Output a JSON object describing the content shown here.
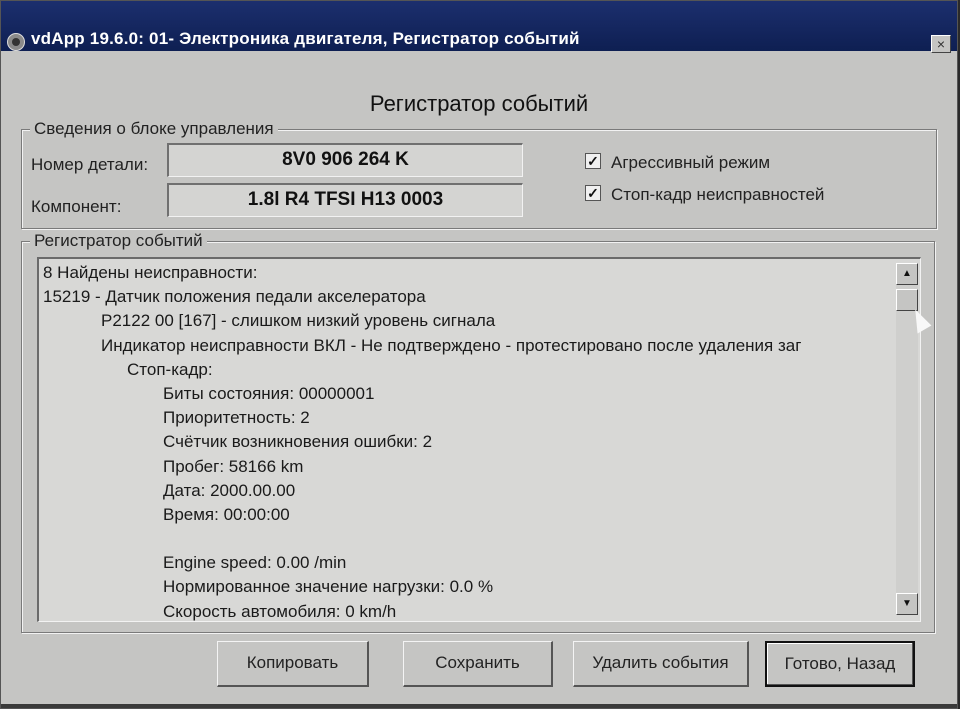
{
  "window": {
    "title": "vdApp 19.6.0: 01- Электроника двигателя, Регистратор событий",
    "close_glyph": "×"
  },
  "heading": "Регистратор событий",
  "control_unit": {
    "legend": "Сведения о блоке управления",
    "part_number_label": "Номер детали:",
    "part_number_value": "8V0 906 264 K",
    "component_label": "Компонент:",
    "component_value": "1.8l R4 TFSI  H13 0003",
    "aggressive_mode_label": "Агрессивный режим",
    "aggressive_mode_checked": true,
    "freeze_frame_label": "Стоп-кадр неисправностей",
    "freeze_frame_checked": true,
    "check_glyph": "✓"
  },
  "event_log": {
    "legend": "Регистратор событий",
    "lines": [
      {
        "indent": 0,
        "text": "8 Найдены неисправности:"
      },
      {
        "indent": 0,
        "text": "15219 - Датчик положения педали акселератора"
      },
      {
        "indent": 1,
        "text": "P2122 00 [167] - слишком низкий уровень сигнала"
      },
      {
        "indent": 1,
        "text": "Индикатор неисправности ВКЛ - Не подтверждено - протестировано после удаления заг"
      },
      {
        "indent": 2,
        "text": "Стоп-кадр:"
      },
      {
        "indent": 3,
        "text": "Биты состояния: 00000001"
      },
      {
        "indent": 3,
        "text": "Приоритетность: 2"
      },
      {
        "indent": 3,
        "text": "Счётчик возникновения ошибки: 2"
      },
      {
        "indent": 3,
        "text": "Пробег: 58166 km"
      },
      {
        "indent": 3,
        "text": "Дата: 2000.00.00"
      },
      {
        "indent": 3,
        "text": "Время: 00:00:00"
      },
      {
        "indent": 3,
        "text": ""
      },
      {
        "indent": 3,
        "text": "Engine speed: 0.00 /min"
      },
      {
        "indent": 3,
        "text": "Нормированное значение нагрузки: 0.0 %"
      },
      {
        "indent": 3,
        "text": "Скорость автомобиля: 0 km/h"
      }
    ],
    "scroll_up_glyph": "▲",
    "scroll_down_glyph": "▼"
  },
  "buttons": {
    "copy": "Копировать",
    "save": "Сохранить",
    "delete_events": "Удалить события",
    "done_back": "Готово, Назад"
  },
  "icons": {
    "app": "app-icon",
    "close": "close-icon",
    "mouse_cursor": "mouse-cursor-icon"
  }
}
